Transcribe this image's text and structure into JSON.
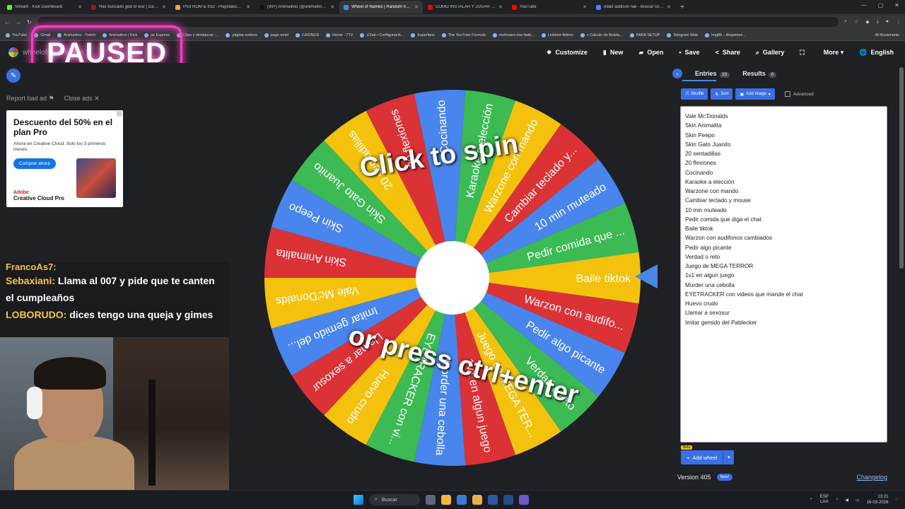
{
  "browser": {
    "tabs": [
      {
        "label": "Stream - Kick Dashboard",
        "color": "#53fc18"
      },
      {
        "label": "Has buscado god of war | Gam...",
        "color": "#a31515"
      },
      {
        "label": "PS3 ROM & ISO - Playstation 3...",
        "color": "#f0a030"
      },
      {
        "label": "(99+) Animalitoo (@animalitoo...",
        "color": "#111111"
      },
      {
        "label": "Wheel of Names | Random nam...",
        "color": "#4885ed",
        "active": true
      },
      {
        "label": "COMO INSTALAR Y JUGAR GO...",
        "color": "#ff0000"
      },
      {
        "label": "YouTube",
        "color": "#ff0000"
      },
      {
        "label": "edad addison rae - Buscar con...",
        "color": "#4285f4"
      }
    ],
    "new_tab": "+",
    "bookmarks": [
      "YouTube",
      "Gmail",
      "Animalitoo - Twitch",
      "Animalitoo | Kick",
      "pe Express",
      "Clips y miniaturas -...",
      "página sorteos",
      "pago emel",
      "CASINOS",
      "Home - 7TV",
      "¡Chat • Configuració...",
      "Superfans",
      "The YouTube Formula",
      "mohicano-low-fade...",
      "Linktree Admin",
      "« Calculo de Boleta...",
      "PARA SETUP",
      "Telegram Web",
      "Img88 – Alojamien..."
    ],
    "all_bookmarks": "All Bookmarks"
  },
  "header": {
    "site_name": "wheelofnames.com",
    "nav": [
      {
        "icon": "✹",
        "label": "Customize"
      },
      {
        "icon": "▮",
        "label": "New"
      },
      {
        "icon": "▰",
        "label": "Open"
      },
      {
        "icon": "▪",
        "label": "Save"
      },
      {
        "icon": "<",
        "label": "Share"
      },
      {
        "icon": "⌕",
        "label": "Gallery"
      },
      {
        "icon": "⛶",
        "label": ""
      },
      {
        "icon": "",
        "label": "More ▾"
      },
      {
        "icon": "🌐",
        "label": "English"
      }
    ]
  },
  "overlay": {
    "paused": "PAUSED"
  },
  "ad": {
    "report": "Report bad ad",
    "close": "Close ads",
    "title": "Descuento del 50% en el plan Pro",
    "sub": "Ahora en Creative Cloud. Solo los 3 primeros meses.",
    "cta": "Comprar ahora",
    "brand_small": "Adobe",
    "brand": "Creative Cloud Pro"
  },
  "chat": {
    "partial_user": "FrancoAs7:",
    "messages": [
      {
        "user": "Sebaxiani:",
        "text": "Llama al 007 y pide que te canten el cumpleaños"
      },
      {
        "user": "LOBORUDO:",
        "text": "dices tengo una queja y gimes"
      }
    ]
  },
  "wheel": {
    "cta_top": "Click to spin",
    "cta_bottom": "or press ctrl+enter",
    "colors": [
      "#4885ed",
      "#3cba54",
      "#f4c20d",
      "#db3236"
    ],
    "segments": [
      "Vale Mc'Donalds",
      "Skin Animalita",
      "Skin Peepo",
      "Skin Gato Juanito",
      "20 sentadillas",
      "20 flexiones",
      "Cocinando",
      "Karaoke a elección",
      "Warzone con mando",
      "Cambiar teclado y...",
      "10 min muteado",
      "Pedir comida que ...",
      "Baile tiktok",
      "Warzon con audifo...",
      "Pedir algo picante",
      "Verdad o reto",
      "Juego de MEGA TER...",
      "1v1 en algun juego",
      "Morder una cebolla",
      "EYETRACKER con vi...",
      "Huevo crudo",
      "Llamar a sexosur",
      "Imitar gemido del..."
    ]
  },
  "panel": {
    "tab_entries": "Entries",
    "entries_count": "23",
    "tab_results": "Results",
    "results_count": "0",
    "shuffle": "Shuffle",
    "sort": "Sort",
    "add_image": "Add image",
    "advanced": "Advanced",
    "entries": [
      "Vale Mc'Donalds",
      "Skin Animalita",
      "Skin Peepo",
      "Skin Gato Juanito",
      "20 sentadillas",
      "20 flexiones",
      "Cocinando",
      "Karaoke a elección",
      "Warzone con mando",
      "Cambiar teclado y mouse",
      "10 min muteado",
      "Pedir comida que diga el chat",
      "Baile tiktok",
      "Warzon con audifonos cambiados",
      "Pedir algo picante",
      "Verdad o reto",
      "Juego de MEGA TERROR",
      "1v1 en algun juego",
      "Morder una cebolla",
      "EYETRACKER con videos que mande el chat",
      "Huevo crudo",
      "Llamar a sexosur",
      "Imitar gemido del Pablecker"
    ],
    "beta": "Beta",
    "add_wheel": "Add wheel",
    "version": "Version 405",
    "new_badge": "New!",
    "changelog": "Changelog"
  },
  "taskbar": {
    "search": "Buscar",
    "lang1": "ESP",
    "lang2": "LAA",
    "time": "13:21",
    "date": "16-03-2026"
  }
}
